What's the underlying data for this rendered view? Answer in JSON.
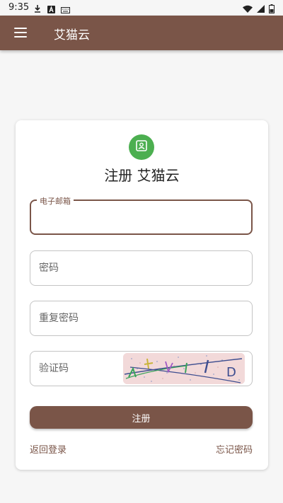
{
  "status_bar": {
    "time": "9:35",
    "icons": [
      "download-icon",
      "a-icon",
      "keyboard-icon",
      "wifi-icon",
      "signal-icon",
      "battery-icon"
    ]
  },
  "app_bar": {
    "menu_icon": "menu-icon",
    "title": "艾猫云",
    "color": "#7a5548"
  },
  "form": {
    "avatar_icon": "contact-icon",
    "avatar_color": "#4caf50",
    "title": "注册 艾猫云",
    "email": {
      "label": "电子邮箱",
      "value": ""
    },
    "password": {
      "placeholder": "密码",
      "value": ""
    },
    "confirm_password": {
      "placeholder": "重复密码",
      "value": ""
    },
    "captcha": {
      "placeholder": "验证码",
      "value": "",
      "image_text": "D"
    },
    "submit_label": "注册",
    "back_to_login": "返回登录",
    "forgot_password": "忘记密码"
  }
}
